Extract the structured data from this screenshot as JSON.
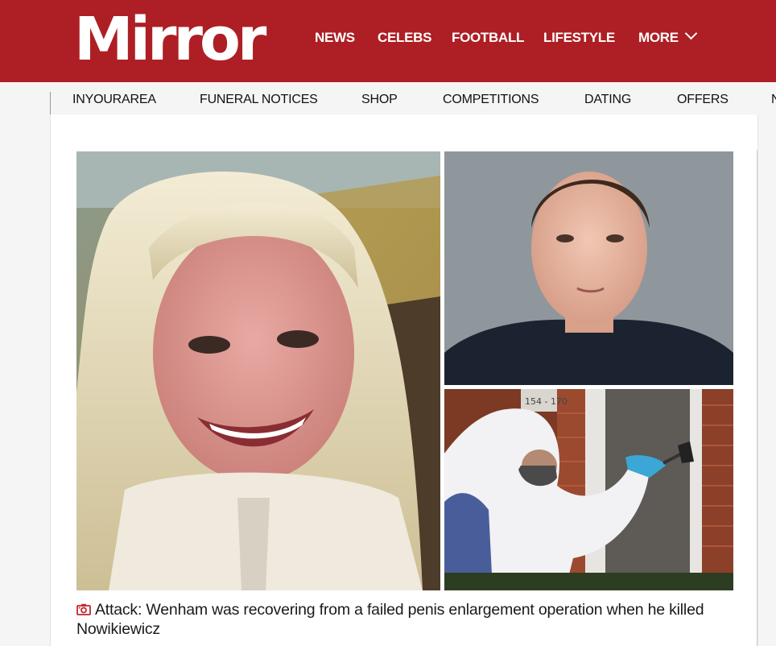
{
  "header": {
    "logo": "Mirror",
    "nav": [
      {
        "label": "NEWS"
      },
      {
        "label": "CELEBS"
      },
      {
        "label": "FOOTBALL"
      },
      {
        "label": "LIFESTYLE"
      },
      {
        "label": "MORE"
      }
    ],
    "brand_color": "#ad1f24"
  },
  "subnav": {
    "items": [
      {
        "label": "INYOURAREA"
      },
      {
        "label": "FUNERAL NOTICES"
      },
      {
        "label": "SHOP"
      },
      {
        "label": "COMPETITIONS"
      },
      {
        "label": "DATING"
      },
      {
        "label": "OFFERS"
      },
      {
        "label": "N"
      }
    ]
  },
  "article": {
    "images": [
      {
        "icon": "woman-portrait-photo"
      },
      {
        "icon": "man-mugshot-photo"
      },
      {
        "icon": "forensic-officer-photo",
        "sign_text": "154 - 170"
      }
    ],
    "caption": "Attack: Wenham was recovering from a failed penis enlargement operation when he killed Nowikiewicz",
    "caption_icon": "camera-icon",
    "caption_icon_color": "#c0282d"
  }
}
